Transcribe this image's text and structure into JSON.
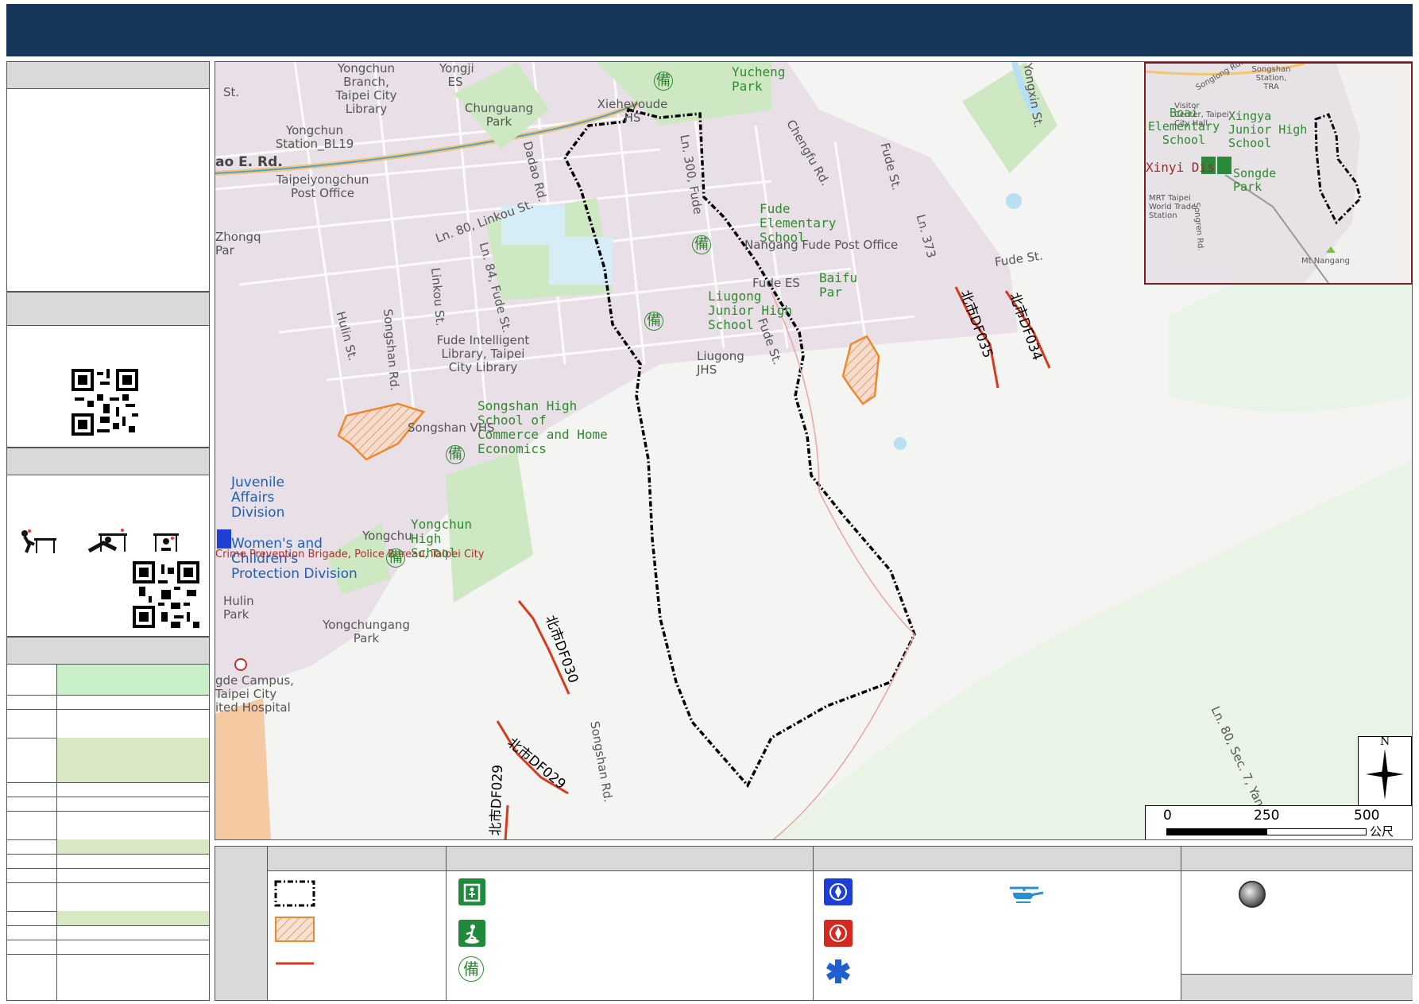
{
  "colors": {
    "title_bar": "#14365a",
    "panel_header": "#d9d9d9",
    "boundary": "#000000",
    "landslide_hatch": "#e98a2e",
    "debris_flow_stream": "#d93a1e",
    "park": "#cfe8c4",
    "inset_border": "#7a1f1f"
  },
  "map_labels": [
    {
      "text": "Yongchun Branch, Taipei City Library",
      "cls": "gray"
    },
    {
      "text": "Yongji ES",
      "cls": "gray"
    },
    {
      "text": "St.",
      "cls": "gray"
    },
    {
      "text": "Chunguang Park",
      "cls": "gray"
    },
    {
      "text": "Xieheyoude HS",
      "cls": "gray"
    },
    {
      "text": "Yucheng Park",
      "cls": "green"
    },
    {
      "text": "Chengfu Rd.",
      "cls": "gray"
    },
    {
      "text": "Yongxin St.",
      "cls": "gray"
    },
    {
      "text": "Yongchun Station_BL19",
      "cls": "gray"
    },
    {
      "text": "ao E. Rd.",
      "cls": "gray"
    },
    {
      "text": "Taipeiyongchun Post Office",
      "cls": "gray"
    },
    {
      "text": "Dadao Rd.",
      "cls": "gray"
    },
    {
      "text": "Ln. 300, Fude",
      "cls": "gray"
    },
    {
      "text": "Fude St.",
      "cls": "gray"
    },
    {
      "text": "Ln. 80, Linkou St.",
      "cls": "gray"
    },
    {
      "text": "Fude Elementary School",
      "cls": "green"
    },
    {
      "text": "Nangang Fude Post Office",
      "cls": "gray"
    },
    {
      "text": "Zhongq Par",
      "cls": "gray"
    },
    {
      "text": "Ln. 84, Fude St.",
      "cls": "gray"
    },
    {
      "text": "Ln. 373",
      "cls": "gray"
    },
    {
      "text": "Fude St.",
      "cls": "gray"
    },
    {
      "text": "Fude ES",
      "cls": "gray"
    },
    {
      "text": "Baifu Par",
      "cls": "green"
    },
    {
      "text": "Liugong Junior High School",
      "cls": "green"
    },
    {
      "text": "Liugong JHS",
      "cls": "gray"
    },
    {
      "text": "Hulin St.",
      "cls": "gray"
    },
    {
      "text": "Songshan Rd.",
      "cls": "gray"
    },
    {
      "text": "Linkou St.",
      "cls": "gray"
    },
    {
      "text": "Fude Intelligent Library, Taipei City Library",
      "cls": "gray"
    },
    {
      "text": "Fude St.",
      "cls": "gray"
    },
    {
      "text": "Songshan High School of Commerce and Home Economics",
      "cls": "green"
    },
    {
      "text": "Songshan VHS",
      "cls": "gray"
    },
    {
      "text": "Juvenile Affairs Division",
      "cls": "blue"
    },
    {
      "text": "Women's and Children's Protection Division",
      "cls": "blue"
    },
    {
      "text": "Crime Prevention Brigade, Police Bureau, Taipei City",
      "cls": "red"
    },
    {
      "text": "Yongchun High School",
      "cls": "green"
    },
    {
      "text": "Yongchu",
      "cls": "gray"
    },
    {
      "text": "Hulin Park",
      "cls": "gray"
    },
    {
      "text": "Yongchungang Park",
      "cls": "gray"
    },
    {
      "text": "gde Campus, Taipei City ited Hospital",
      "cls": "gray"
    },
    {
      "text": "Songshan Rd.",
      "cls": "gray"
    },
    {
      "text": "Ln. 80, Sec. 7, Yan",
      "cls": "gray"
    }
  ],
  "debris_flows": [
    "北市DF035",
    "北市DF034",
    "北市DF030",
    "北市DF029",
    "北市DF029"
  ],
  "inset_labels": [
    "Songshan Station, TRA",
    "Songlong Rd.",
    "Visitor Center, Taipei City Hall",
    "Boai Elementary School",
    "Xingya Junior High School",
    "Xinyi Dis",
    "Songde Park",
    "MRT Taipei World Trade Station",
    "Songren Rd.",
    "Mt Nangang"
  ],
  "scale_bar": {
    "ticks": [
      "0",
      "250",
      "500"
    ],
    "unit": "公尺"
  },
  "north_arrow": "N",
  "legend_symbols": {
    "shelter_char": "備"
  }
}
